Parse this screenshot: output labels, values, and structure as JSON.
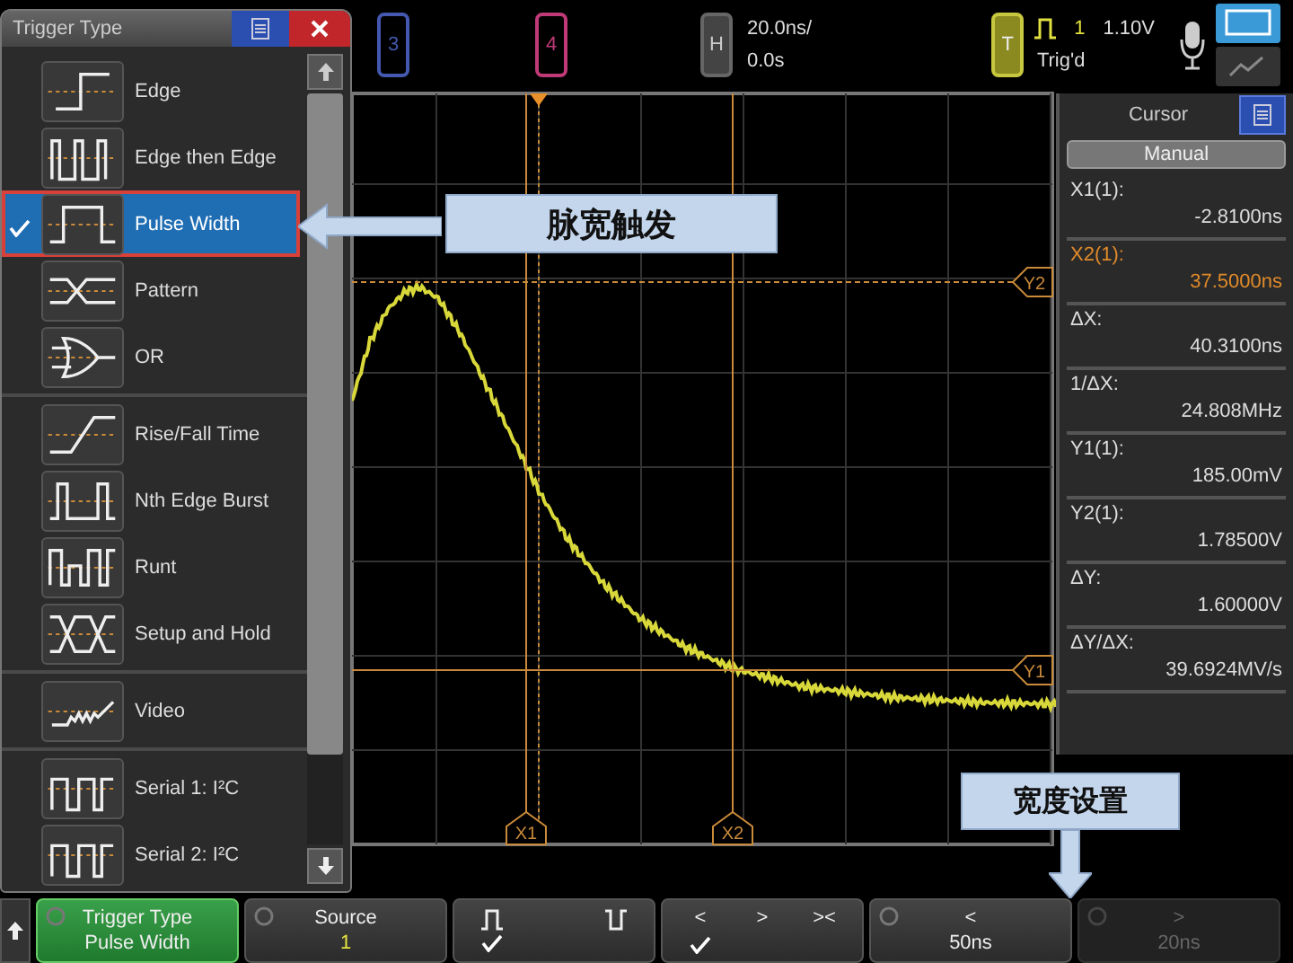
{
  "top_bar": {
    "channels": [
      {
        "label": "3",
        "color": "#4458b0"
      },
      {
        "label": "4",
        "color": "#c03a78"
      }
    ],
    "horizontal": {
      "badge": "H",
      "scale": "20.0ns/",
      "delay": "0.0s"
    },
    "trigger": {
      "badge": "T",
      "source": "1",
      "status": "Trig'd",
      "level": "1.10V"
    }
  },
  "trigger_dialog": {
    "title": "Trigger Type",
    "groups": [
      {
        "items": [
          {
            "label": "Edge",
            "kind": "edge",
            "selected": false
          },
          {
            "label": "Edge then Edge",
            "kind": "edge-then-edge",
            "selected": false
          },
          {
            "label": "Pulse Width",
            "kind": "pulse",
            "selected": true
          },
          {
            "label": "Pattern",
            "kind": "pattern",
            "selected": false
          },
          {
            "label": "OR",
            "kind": "or",
            "selected": false
          }
        ]
      },
      {
        "items": [
          {
            "label": "Rise/Fall Time",
            "kind": "rise-fall",
            "selected": false
          },
          {
            "label": "Nth Edge Burst",
            "kind": "nth-edge",
            "selected": false
          },
          {
            "label": "Runt",
            "kind": "runt",
            "selected": false
          },
          {
            "label": "Setup and Hold",
            "kind": "setup-hold",
            "selected": false
          }
        ]
      },
      {
        "items": [
          {
            "label": "Video",
            "kind": "video",
            "selected": false
          }
        ]
      },
      {
        "items": [
          {
            "label": "Serial 1: I²C",
            "kind": "serial",
            "selected": false
          },
          {
            "label": "Serial 2: I²C",
            "kind": "serial",
            "selected": false
          }
        ]
      }
    ]
  },
  "scope": {
    "cursors": [
      {
        "label": "X1",
        "kind": "vertical"
      },
      {
        "label": "X2",
        "kind": "vertical"
      },
      {
        "label": "Y1",
        "kind": "horizontal"
      },
      {
        "label": "Y2",
        "kind": "horizontal"
      }
    ]
  },
  "cursor_panel": {
    "title": "Cursor",
    "mode": "Manual",
    "readings": [
      {
        "label": "X1(1):",
        "value": "-2.8100ns",
        "selected": false
      },
      {
        "label": "X2(1):",
        "value": "37.5000ns",
        "selected": true
      },
      {
        "label": "ΔX:",
        "value": "40.3100ns",
        "selected": false
      },
      {
        "label": "1/ΔX:",
        "value": "24.808MHz",
        "selected": false
      },
      {
        "label": "Y1(1):",
        "value": "185.00mV",
        "selected": false
      },
      {
        "label": "Y2(1):",
        "value": "1.78500V",
        "selected": false
      },
      {
        "label": "ΔY:",
        "value": "1.60000V",
        "selected": false
      },
      {
        "label": "ΔY/ΔX:",
        "value": "39.6924MV/s",
        "selected": false
      }
    ]
  },
  "callouts": [
    {
      "text": "脉宽触发",
      "kind": "left"
    },
    {
      "text": "宽度设置",
      "kind": "down"
    }
  ],
  "softkeys": [
    {
      "kind": "menu",
      "title": "Trigger Type",
      "value": "Pulse Width",
      "selected": true,
      "disabled": false
    },
    {
      "kind": "menu",
      "title": "Source",
      "value": "1",
      "selected": false,
      "disabled": false
    },
    {
      "kind": "options",
      "options": [
        {
          "kind": "positive-pulse",
          "selected": true
        },
        {
          "kind": "negative-pulse",
          "selected": false
        }
      ]
    },
    {
      "kind": "options",
      "options": [
        {
          "label": "<",
          "selected": true
        },
        {
          "label": ">",
          "selected": false
        },
        {
          "label": "><",
          "selected": false
        }
      ]
    },
    {
      "kind": "menu",
      "title": "<",
      "value": "50ns",
      "selected": false,
      "disabled": false
    },
    {
      "kind": "menu",
      "title": ">",
      "value": "20ns",
      "selected": false,
      "disabled": true
    }
  ]
}
